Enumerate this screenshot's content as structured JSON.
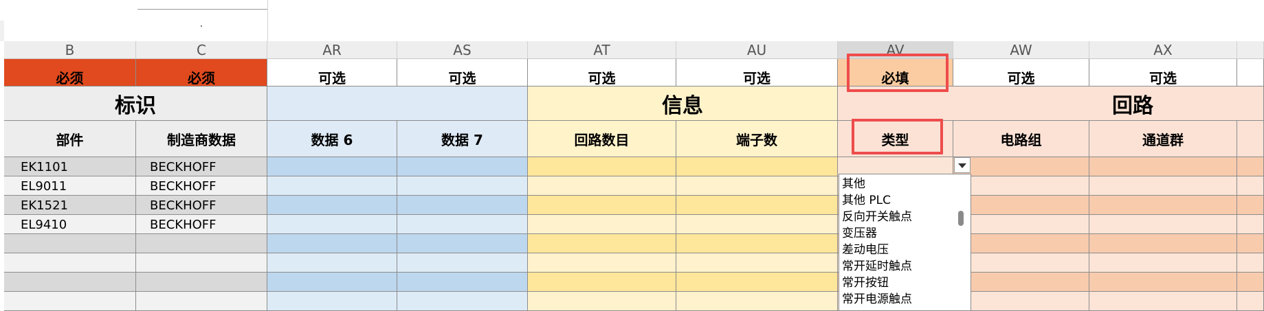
{
  "columns": [
    {
      "letter": "B",
      "required": "必须",
      "header": "部件"
    },
    {
      "letter": "C",
      "required": "必须",
      "header": "制造商数据"
    },
    {
      "letter": "AR",
      "required": "可选",
      "header": "数据 6"
    },
    {
      "letter": "AS",
      "required": "可选",
      "header": "数据 7"
    },
    {
      "letter": "AT",
      "required": "可选",
      "header": "回路数目"
    },
    {
      "letter": "AU",
      "required": "可选",
      "header": "端子数"
    },
    {
      "letter": "AV",
      "required": "必填",
      "header": "类型"
    },
    {
      "letter": "AW",
      "required": "可选",
      "header": "电路组"
    },
    {
      "letter": "AX",
      "required": "可选",
      "header": "通道群"
    }
  ],
  "groups": {
    "identity": "标识",
    "info": "信息",
    "circuit": "回路"
  },
  "rows": [
    {
      "part": "EK1101",
      "manufacturer": "BECKHOFF"
    },
    {
      "part": "EL9011",
      "manufacturer": "BECKHOFF"
    },
    {
      "part": "EK1521",
      "manufacturer": "BECKHOFF"
    },
    {
      "part": "EL9410",
      "manufacturer": "BECKHOFF"
    },
    {
      "part": "",
      "manufacturer": ""
    },
    {
      "part": "",
      "manufacturer": ""
    },
    {
      "part": "",
      "manufacturer": ""
    },
    {
      "part": "",
      "manufacturer": ""
    }
  ],
  "dropdown": {
    "options": [
      "其他",
      "其他 PLC",
      "反向开关触点",
      "变压器",
      "差动电压",
      "常开延时触点",
      "常开按钮",
      "常开电源触点"
    ]
  },
  "colors": {
    "required_red": "#e04a1e",
    "identity_gray": "#ededed",
    "blue_header": "#deeaf6",
    "yellow_header": "#fff3ca",
    "salmon_header": "#fbe2d5",
    "highlight_orange": "#fbcca1",
    "outline_red": "#ee4c4c"
  }
}
